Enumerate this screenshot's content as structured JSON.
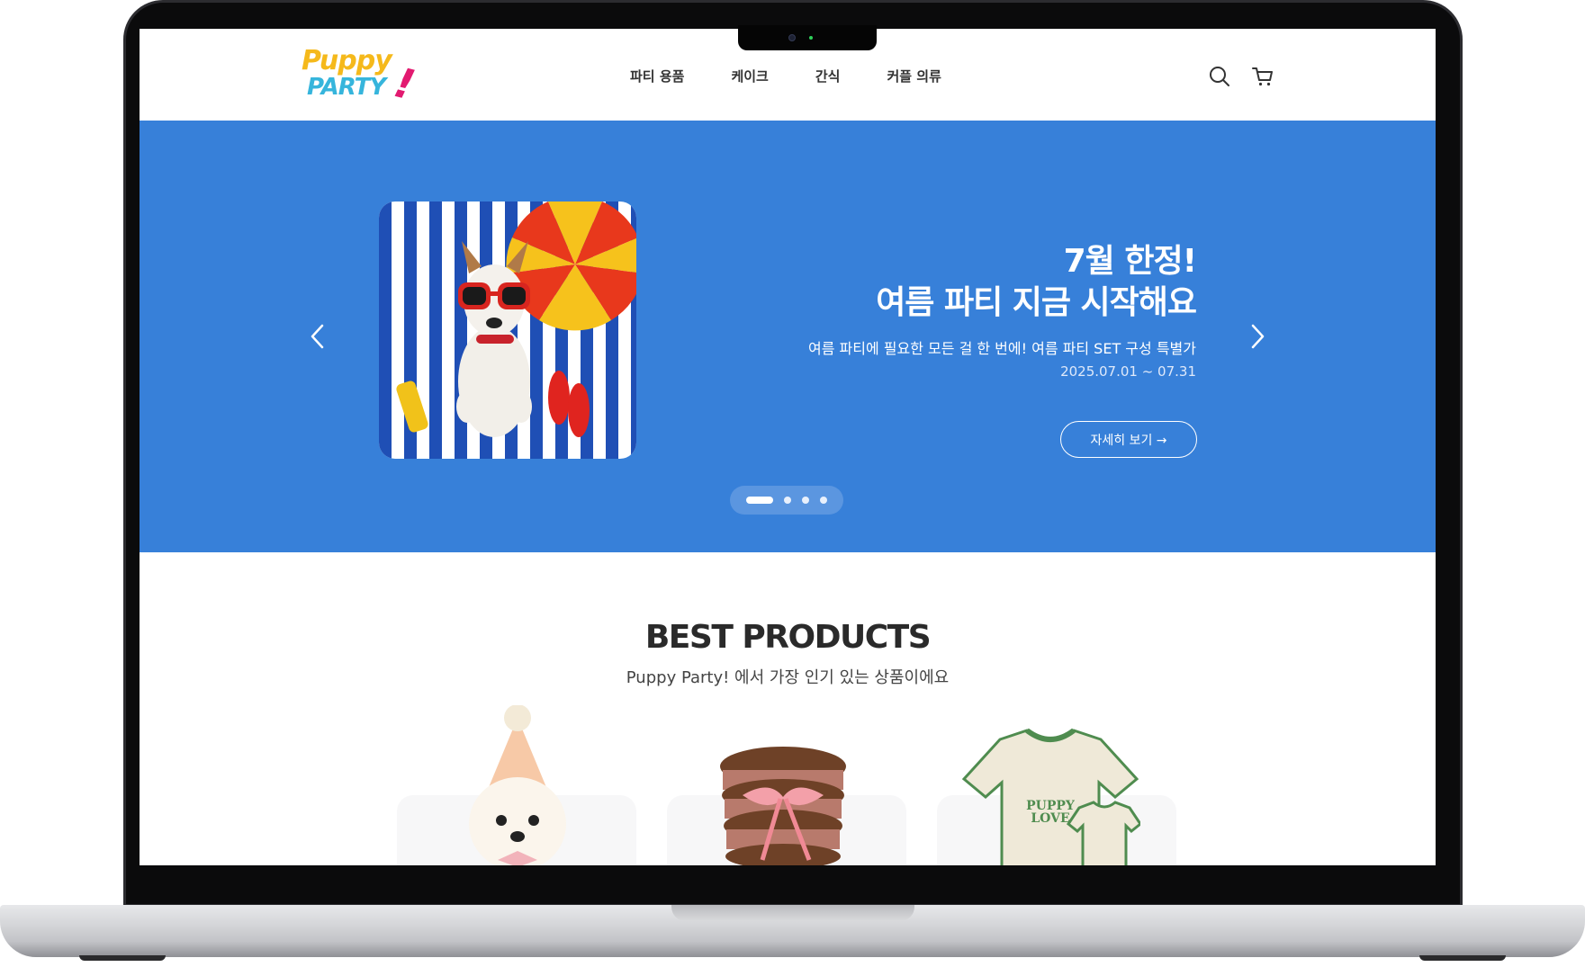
{
  "header": {
    "logo": {
      "line1": "Puppy",
      "line2": "PARTY",
      "mark": "!"
    },
    "nav": [
      "파티 용품",
      "케이크",
      "간식",
      "커플 의류"
    ],
    "icons": [
      "search-icon",
      "cart-icon"
    ]
  },
  "hero": {
    "title_line1": "7월 한정!",
    "title_line2": "여름 파티 지금 시작해요",
    "subtitle": "여름 파티에 필요한 모든 걸 한 번에! 여름 파티 SET 구성 특별가",
    "date": "2025.07.01 ~ 07.31",
    "cta": "자세히 보기 →",
    "slides": 4,
    "active_slide": 1,
    "background": "#3780d9"
  },
  "best": {
    "title": "BEST PRODUCTS",
    "subtitle": "Puppy Party! 에서 가장 인기 있는 상품이에요",
    "products": [
      {
        "name": "party-hat-puppy",
        "badge_color": "#e3b53a"
      },
      {
        "name": "ribbon-cookie-cake",
        "badge_color": "#a9c6dc"
      },
      {
        "name": "couple-tshirt",
        "badge_color": "#e49a46",
        "print_text": "PUPPY LOVE"
      }
    ]
  },
  "colors": {
    "accent": "#3780d9",
    "logo_yellow": "#f5b91b",
    "logo_blue": "#36b5dc",
    "logo_pink": "#e21a70"
  }
}
